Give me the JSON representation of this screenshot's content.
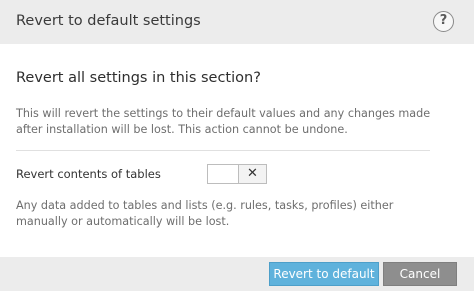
{
  "dialog": {
    "title": "Revert to default settings",
    "help_icon": "question-mark-icon",
    "help_label": "?"
  },
  "main": {
    "question": "Revert all settings in this section?",
    "description": "This will revert the settings to their default values and any changes made after installation will be lost. This action cannot be undone."
  },
  "option": {
    "label": "Revert contents of tables",
    "toggle_state": "off",
    "toggle_icon": "x-icon",
    "toggle_glyph": "✕",
    "note": "Any data added to tables and lists (e.g. rules, tasks, profiles) either manually or automatically will be lost."
  },
  "footer": {
    "revert_label": "Revert to default",
    "cancel_label": "Cancel"
  },
  "colors": {
    "header_bg": "#ececec",
    "primary_button": "#5fb2dc",
    "secondary_button": "#8e8e8e"
  }
}
